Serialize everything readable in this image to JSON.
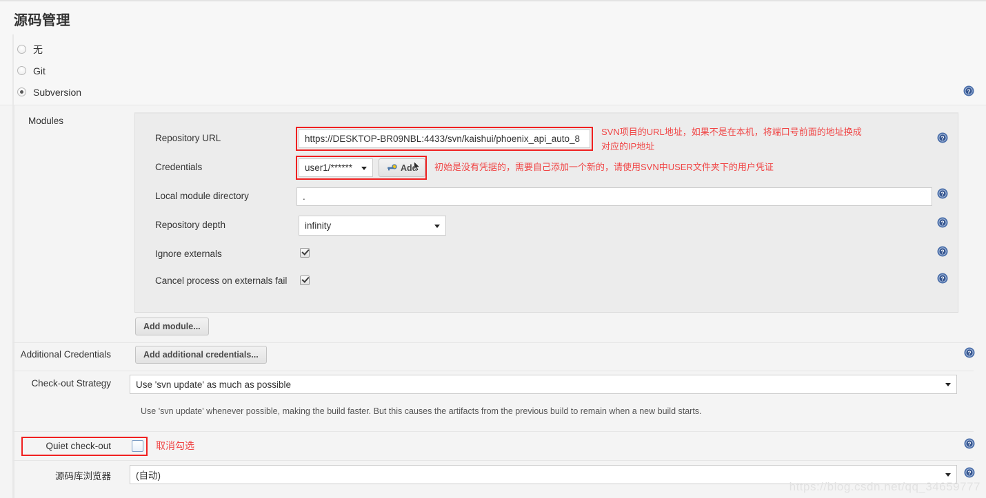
{
  "page": {
    "title": "源码管理",
    "watermark": "https://blog.csdn.net/qq_34659777"
  },
  "scm_options": [
    {
      "label": "无",
      "selected": false
    },
    {
      "label": "Git",
      "selected": false
    },
    {
      "label": "Subversion",
      "selected": true
    }
  ],
  "modules": {
    "section_label": "Modules",
    "repository_url": {
      "label": "Repository URL",
      "value": "https://DESKTOP-BR09NBL:4433/svn/kaishui/phoenix_api_auto_8",
      "annotation_line1": "SVN项目的URL地址，如果不是在本机，将端口号前面的地址换成",
      "annotation_line2": "对应的IP地址"
    },
    "credentials": {
      "label": "Credentials",
      "value": "user1/******",
      "add_button": "Add",
      "add_button_icon": "key-icon",
      "annotation": "初始是没有凭据的，需要自己添加一个新的，请使用SVN中USER文件夹下的用户凭证"
    },
    "local_module_directory": {
      "label": "Local module directory",
      "value": "."
    },
    "repository_depth": {
      "label": "Repository depth",
      "value": "infinity"
    },
    "ignore_externals": {
      "label": "Ignore externals",
      "checked": true
    },
    "cancel_process_on_externals_fail": {
      "label": "Cancel process on externals fail",
      "checked": true
    },
    "add_module_button": "Add module..."
  },
  "additional_credentials": {
    "label": "Additional Credentials",
    "button": "Add additional credentials..."
  },
  "checkout_strategy": {
    "label": "Check-out Strategy",
    "value": "Use 'svn update' as much as possible",
    "description": "Use 'svn update' whenever possible, making the build faster. But this causes the artifacts from the previous build to remain when a new build starts."
  },
  "quiet_checkout": {
    "label": "Quiet check-out",
    "checked": false,
    "annotation": "取消勾选"
  },
  "repository_browser": {
    "label": "源码库浏览器",
    "value": "(自动)"
  },
  "icons": {
    "help": "help-icon"
  },
  "colors": {
    "annotation_red": "#f04545",
    "redbox_border": "#f02020",
    "help_blue": "#3a5f9e",
    "panel_bg": "#ececec",
    "page_bg": "#f7f7f7"
  }
}
